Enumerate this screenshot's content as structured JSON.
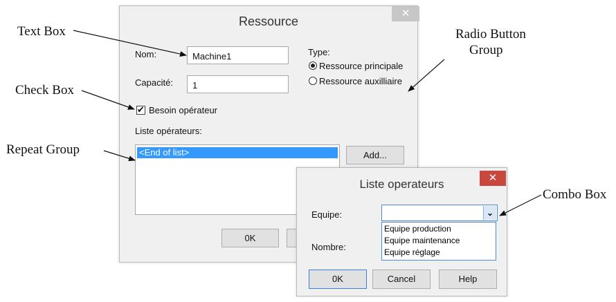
{
  "annotations": {
    "text_box": "Text Box",
    "check_box": "Check Box",
    "repeat_group": "Repeat Group",
    "radio_group_line1": "Radio Button",
    "radio_group_line2": "Group",
    "combo_box": "Combo Box"
  },
  "ressource_dialog": {
    "title": "Ressource",
    "close_icon": "close-icon",
    "nom_label": "Nom:",
    "nom_value": "Machine1",
    "capacite_label": "Capacité:",
    "capacite_value": "1",
    "type_label": "Type:",
    "radio_options": [
      {
        "label": "Ressource principale",
        "selected": true
      },
      {
        "label": "Ressource auxilliaire",
        "selected": false
      }
    ],
    "besoin_label": "Besoin opérateur",
    "besoin_checked": true,
    "liste_label": "Liste opérateurs:",
    "list_items": [
      "<End of list>"
    ],
    "add_button": "Add...",
    "ok_button": "0K"
  },
  "liste_dialog": {
    "title": "Liste operateurs",
    "close_icon": "close-icon",
    "equipe_label": "Equipe:",
    "equipe_value": "",
    "nombre_label": "Nombre:",
    "dropdown_options": [
      "Equipe production",
      "Equipe maintenance",
      "Equipe réglage"
    ],
    "ok_button": "0K",
    "cancel_button": "Cancel",
    "help_button": "Help"
  },
  "colors": {
    "selection": "#3399ff",
    "close_red": "#c9473d",
    "close_gray": "#c7c7c7",
    "combo_border": "#4a8ad6"
  }
}
